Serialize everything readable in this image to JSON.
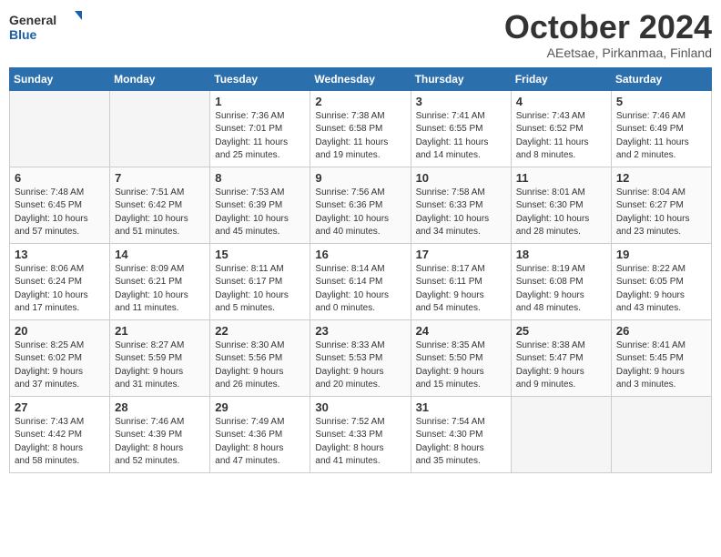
{
  "header": {
    "logo_line1": "General",
    "logo_line2": "Blue",
    "month": "October 2024",
    "location": "AEetsae, Pirkanmaa, Finland"
  },
  "days_of_week": [
    "Sunday",
    "Monday",
    "Tuesday",
    "Wednesday",
    "Thursday",
    "Friday",
    "Saturday"
  ],
  "weeks": [
    [
      {
        "day": "",
        "info": ""
      },
      {
        "day": "",
        "info": ""
      },
      {
        "day": "1",
        "info": "Sunrise: 7:36 AM\nSunset: 7:01 PM\nDaylight: 11 hours\nand 25 minutes."
      },
      {
        "day": "2",
        "info": "Sunrise: 7:38 AM\nSunset: 6:58 PM\nDaylight: 11 hours\nand 19 minutes."
      },
      {
        "day": "3",
        "info": "Sunrise: 7:41 AM\nSunset: 6:55 PM\nDaylight: 11 hours\nand 14 minutes."
      },
      {
        "day": "4",
        "info": "Sunrise: 7:43 AM\nSunset: 6:52 PM\nDaylight: 11 hours\nand 8 minutes."
      },
      {
        "day": "5",
        "info": "Sunrise: 7:46 AM\nSunset: 6:49 PM\nDaylight: 11 hours\nand 2 minutes."
      }
    ],
    [
      {
        "day": "6",
        "info": "Sunrise: 7:48 AM\nSunset: 6:45 PM\nDaylight: 10 hours\nand 57 minutes."
      },
      {
        "day": "7",
        "info": "Sunrise: 7:51 AM\nSunset: 6:42 PM\nDaylight: 10 hours\nand 51 minutes."
      },
      {
        "day": "8",
        "info": "Sunrise: 7:53 AM\nSunset: 6:39 PM\nDaylight: 10 hours\nand 45 minutes."
      },
      {
        "day": "9",
        "info": "Sunrise: 7:56 AM\nSunset: 6:36 PM\nDaylight: 10 hours\nand 40 minutes."
      },
      {
        "day": "10",
        "info": "Sunrise: 7:58 AM\nSunset: 6:33 PM\nDaylight: 10 hours\nand 34 minutes."
      },
      {
        "day": "11",
        "info": "Sunrise: 8:01 AM\nSunset: 6:30 PM\nDaylight: 10 hours\nand 28 minutes."
      },
      {
        "day": "12",
        "info": "Sunrise: 8:04 AM\nSunset: 6:27 PM\nDaylight: 10 hours\nand 23 minutes."
      }
    ],
    [
      {
        "day": "13",
        "info": "Sunrise: 8:06 AM\nSunset: 6:24 PM\nDaylight: 10 hours\nand 17 minutes."
      },
      {
        "day": "14",
        "info": "Sunrise: 8:09 AM\nSunset: 6:21 PM\nDaylight: 10 hours\nand 11 minutes."
      },
      {
        "day": "15",
        "info": "Sunrise: 8:11 AM\nSunset: 6:17 PM\nDaylight: 10 hours\nand 5 minutes."
      },
      {
        "day": "16",
        "info": "Sunrise: 8:14 AM\nSunset: 6:14 PM\nDaylight: 10 hours\nand 0 minutes."
      },
      {
        "day": "17",
        "info": "Sunrise: 8:17 AM\nSunset: 6:11 PM\nDaylight: 9 hours\nand 54 minutes."
      },
      {
        "day": "18",
        "info": "Sunrise: 8:19 AM\nSunset: 6:08 PM\nDaylight: 9 hours\nand 48 minutes."
      },
      {
        "day": "19",
        "info": "Sunrise: 8:22 AM\nSunset: 6:05 PM\nDaylight: 9 hours\nand 43 minutes."
      }
    ],
    [
      {
        "day": "20",
        "info": "Sunrise: 8:25 AM\nSunset: 6:02 PM\nDaylight: 9 hours\nand 37 minutes."
      },
      {
        "day": "21",
        "info": "Sunrise: 8:27 AM\nSunset: 5:59 PM\nDaylight: 9 hours\nand 31 minutes."
      },
      {
        "day": "22",
        "info": "Sunrise: 8:30 AM\nSunset: 5:56 PM\nDaylight: 9 hours\nand 26 minutes."
      },
      {
        "day": "23",
        "info": "Sunrise: 8:33 AM\nSunset: 5:53 PM\nDaylight: 9 hours\nand 20 minutes."
      },
      {
        "day": "24",
        "info": "Sunrise: 8:35 AM\nSunset: 5:50 PM\nDaylight: 9 hours\nand 15 minutes."
      },
      {
        "day": "25",
        "info": "Sunrise: 8:38 AM\nSunset: 5:47 PM\nDaylight: 9 hours\nand 9 minutes."
      },
      {
        "day": "26",
        "info": "Sunrise: 8:41 AM\nSunset: 5:45 PM\nDaylight: 9 hours\nand 3 minutes."
      }
    ],
    [
      {
        "day": "27",
        "info": "Sunrise: 7:43 AM\nSunset: 4:42 PM\nDaylight: 8 hours\nand 58 minutes."
      },
      {
        "day": "28",
        "info": "Sunrise: 7:46 AM\nSunset: 4:39 PM\nDaylight: 8 hours\nand 52 minutes."
      },
      {
        "day": "29",
        "info": "Sunrise: 7:49 AM\nSunset: 4:36 PM\nDaylight: 8 hours\nand 47 minutes."
      },
      {
        "day": "30",
        "info": "Sunrise: 7:52 AM\nSunset: 4:33 PM\nDaylight: 8 hours\nand 41 minutes."
      },
      {
        "day": "31",
        "info": "Sunrise: 7:54 AM\nSunset: 4:30 PM\nDaylight: 8 hours\nand 35 minutes."
      },
      {
        "day": "",
        "info": ""
      },
      {
        "day": "",
        "info": ""
      }
    ]
  ]
}
